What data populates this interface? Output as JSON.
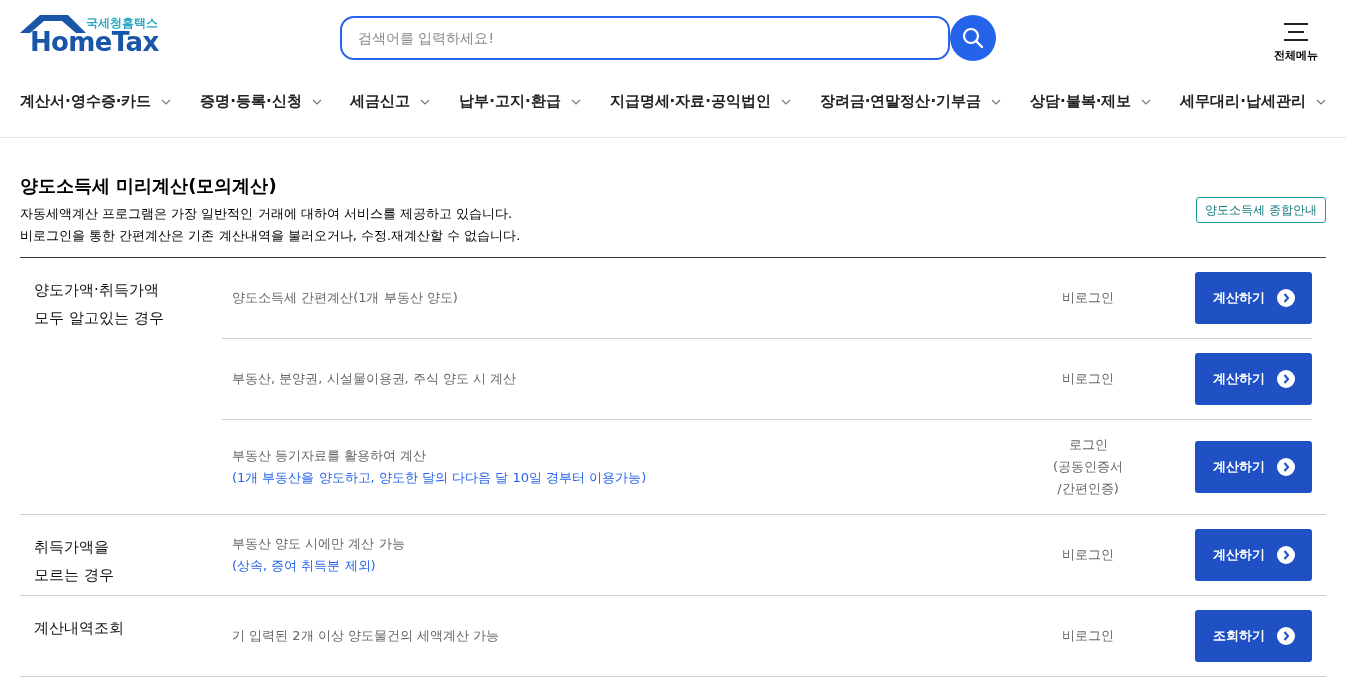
{
  "logo": {
    "subtitle": "국세청홈택스",
    "name": "HomeTax"
  },
  "search": {
    "placeholder": "검색어를 입력하세요!"
  },
  "all_menu": {
    "label": "전체메뉴"
  },
  "nav": [
    "계산서·영수증·카드",
    "증명·등록·신청",
    "세금신고",
    "납부·고지·환급",
    "지급명세·자료·공익법인",
    "장려금·연말정산·기부금",
    "상담·불복·제보",
    "세무대리·납세관리"
  ],
  "page": {
    "title": "양도소득세 미리계산(모의계산)",
    "notes": [
      "자동세액계산 프로그램은 가장 일반적인 거래에 대하여 서비스를 제공하고 있습니다.",
      "비로그인을 통한 간편계산은 기존 계산내역을 불러오거나, 수정.재계산할 수 없습니다."
    ],
    "guide_button": "양도소득세 종합안내"
  },
  "groups": [
    {
      "label": [
        "양도가액·취득가액",
        "모두 알고있는 경우"
      ],
      "rows": [
        {
          "description": "양도소득세 간편계산(1개 부동산 양도)",
          "login": [
            "비로그인"
          ],
          "button": "계산하기"
        },
        {
          "description": "부동산, 분양권, 시설물이용권, 주식 양도 시 계산",
          "login": [
            "비로그인"
          ],
          "button": "계산하기"
        },
        {
          "description": "부동산 등기자료를 활용하여 계산",
          "note": "(1개 부동산을 양도하고, 양도한 달의 다다음 달 10일 경부터 이용가능)",
          "login": [
            "로그인",
            "(공동인증서",
            "/간편인증)"
          ],
          "button": "계산하기"
        }
      ]
    },
    {
      "label": [
        "취득가액을",
        "모르는 경우"
      ],
      "rows": [
        {
          "description": "부동산 양도 시에만 계산 가능",
          "note": "(상속, 증여 취득분 제외)",
          "login": [
            "비로그인"
          ],
          "button": "계산하기"
        }
      ]
    },
    {
      "label": [
        "계산내역조회"
      ],
      "rows": [
        {
          "description": "기 입력된 2개 이상 양도물건의 세액계산 가능",
          "login": [
            "비로그인"
          ],
          "button": "조회하기"
        }
      ]
    }
  ]
}
